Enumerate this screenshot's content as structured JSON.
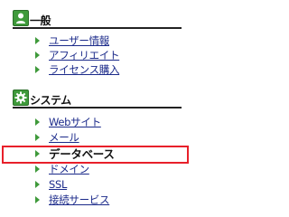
{
  "sections": [
    {
      "title": "一般",
      "icon": "user-icon",
      "items": [
        {
          "label": "ユーザー情報"
        },
        {
          "label": "アフィリエイト"
        },
        {
          "label": "ライセンス購入"
        }
      ]
    },
    {
      "title": "システム",
      "icon": "gear-icon",
      "items": [
        {
          "label": "Webサイト"
        },
        {
          "label": "メール"
        },
        {
          "label": "データベース"
        },
        {
          "label": "ドメイン"
        },
        {
          "label": "SSL"
        },
        {
          "label": "接続サービス"
        }
      ]
    }
  ],
  "highlight_color": "#e8202a",
  "accent_color": "#3f9a3b",
  "link_color": "#1b2a8a"
}
